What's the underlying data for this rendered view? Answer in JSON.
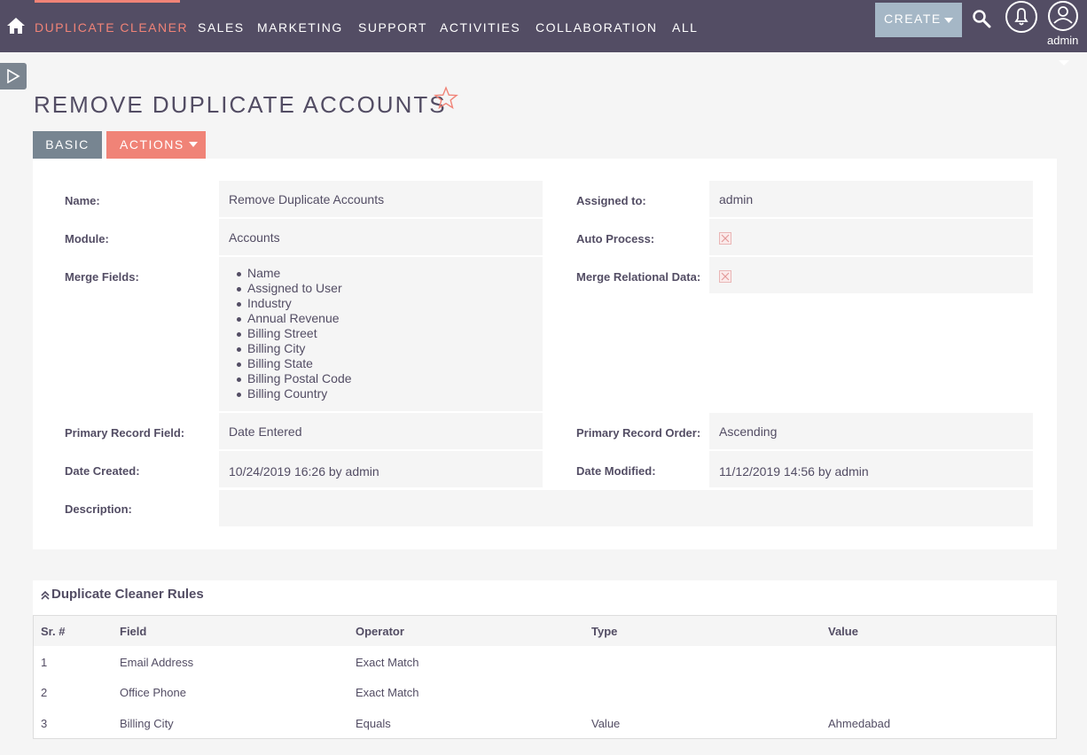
{
  "nav": {
    "items": [
      "Duplicate Cleaner",
      "Sales",
      "Marketing",
      "Support",
      "Activities",
      "Collaboration",
      "All"
    ],
    "create_label": "CREATE",
    "user_name": "admin"
  },
  "page": {
    "title": "REMOVE DUPLICATE ACCOUNTS",
    "tabs": {
      "basic": "BASIC",
      "actions": "ACTIONS"
    }
  },
  "detail": {
    "name_label": "Name:",
    "name_value": "Remove Duplicate Accounts",
    "assigned_label": "Assigned to:",
    "assigned_value": "admin",
    "module_label": "Module:",
    "module_value": "Accounts",
    "auto_process_label": "Auto Process:",
    "auto_process_checked": false,
    "merge_fields_label": "Merge Fields:",
    "merge_fields": [
      "Name",
      "Assigned to User",
      "Industry",
      "Annual Revenue",
      "Billing Street",
      "Billing City",
      "Billing State",
      "Billing Postal Code",
      "Billing Country"
    ],
    "merge_relational_label": "Merge Relational Data:",
    "merge_relational_checked": false,
    "primary_field_label": "Primary Record Field:",
    "primary_field_value": "Date Entered",
    "primary_order_label": "Primary Record Order:",
    "primary_order_value": "Ascending",
    "date_created_label": "Date Created:",
    "date_created_value": "10/24/2019 16:26 by admin",
    "date_modified_label": "Date Modified:",
    "date_modified_value": "11/12/2019 14:56 by admin",
    "description_label": "Description:",
    "description_value": ""
  },
  "rules": {
    "title": "Duplicate Cleaner Rules",
    "columns": [
      "Sr. #",
      "Field",
      "Operator",
      "Type",
      "Value"
    ],
    "rows": [
      [
        "1",
        "Email Address",
        "Exact Match",
        "",
        ""
      ],
      [
        "2",
        "Office Phone",
        "Exact Match",
        "",
        ""
      ],
      [
        "3",
        "Billing City",
        "Equals",
        "Value",
        "Ahmedabad"
      ]
    ]
  },
  "colors": {
    "nav_bg": "#534d64",
    "accent": "#f08377",
    "create_bg": "#a5b7c6",
    "tab_basic_bg": "#778591",
    "field_bg": "#f5f5f5"
  }
}
